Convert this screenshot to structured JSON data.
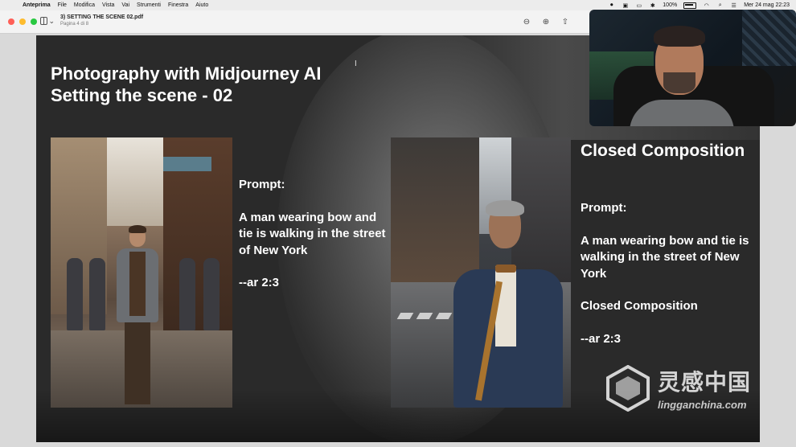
{
  "menubar": {
    "app_name": "Anteprima",
    "items": [
      "File",
      "Modifica",
      "Vista",
      "Vai",
      "Strumenti",
      "Finestra",
      "Aiuto"
    ],
    "battery": "100%",
    "datetime": "Mer 24 mag  22:23"
  },
  "window": {
    "doc_title": "3) SETTING THE SCENE 02.pdf",
    "page_info": "Pagina 4 di 8"
  },
  "slide": {
    "title_line1": "Photography with Midjourney AI",
    "title_line2": "Setting the scene - 02",
    "left": {
      "prompt_label": "Prompt:",
      "prompt_text": "A man wearing bow and tie is walking in the street of New York",
      "param": "--ar 2:3"
    },
    "right": {
      "heading": "Closed Composition",
      "prompt_label": "Prompt:",
      "prompt_text": "A man wearing bow and tie is walking in the street of New York",
      "composition": "Closed Composition",
      "param": "--ar 2:3"
    }
  },
  "watermark": {
    "cn": "灵感中国",
    "en": "lingganchina.com"
  },
  "colors": {
    "red_light": "#ff5f57",
    "yellow_light": "#febc2e",
    "green_light": "#28c840"
  }
}
